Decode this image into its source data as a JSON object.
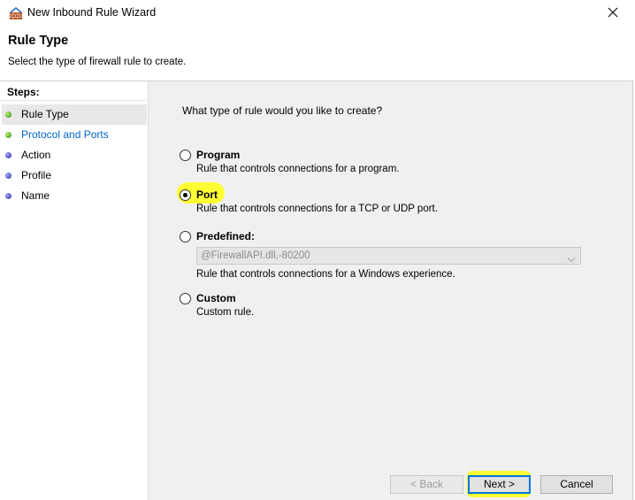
{
  "window": {
    "title": "New Inbound Rule Wizard",
    "app_icon": "firewall-wall-icon",
    "close_icon": "close-icon"
  },
  "header": {
    "title": "Rule Type",
    "subtitle": "Select the type of firewall rule to create."
  },
  "steps": {
    "heading": "Steps:",
    "items": [
      {
        "label": "Rule Type",
        "state": "current",
        "dot": "green"
      },
      {
        "label": "Protocol and Ports",
        "state": "link",
        "dot": "green"
      },
      {
        "label": "Action",
        "state": "pending",
        "dot": "blue"
      },
      {
        "label": "Profile",
        "state": "pending",
        "dot": "blue"
      },
      {
        "label": "Name",
        "state": "pending",
        "dot": "blue"
      }
    ]
  },
  "main": {
    "question": "What type of rule would you like to create?",
    "options": [
      {
        "label": "Program",
        "description": "Rule that controls connections for a program.",
        "selected": false
      },
      {
        "label": "Port",
        "description": "Rule that controls connections for a TCP or UDP port.",
        "selected": true
      },
      {
        "label": "Predefined:",
        "description": "Rule that controls connections for a Windows experience.",
        "selected": false
      },
      {
        "label": "Custom",
        "description": "Custom rule.",
        "selected": false
      }
    ],
    "predefined_dropdown": {
      "value": "@FirewallAPI.dll,-80200",
      "disabled": true
    }
  },
  "buttons": {
    "back": "< Back",
    "next": "Next >",
    "cancel": "Cancel"
  },
  "colors": {
    "highlight": "#ffff33",
    "accent": "#0078d7",
    "link": "#0066cc"
  }
}
